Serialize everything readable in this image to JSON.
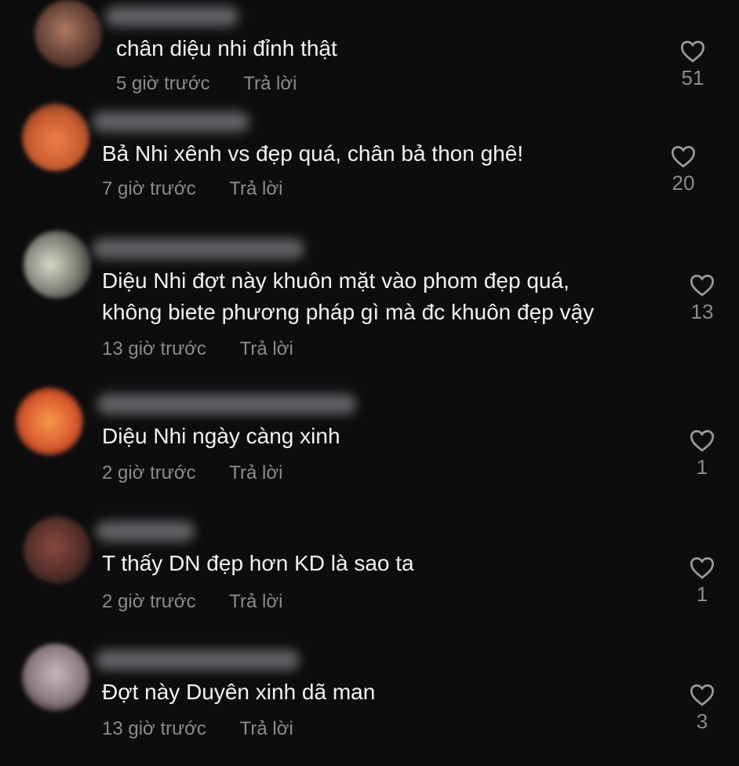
{
  "comments": [
    {
      "text_lines": [
        "chân diệu nhi đỉnh thật"
      ],
      "time": "5 giờ trước",
      "reply": "Trả lời",
      "likes": "51",
      "avatar_color": "#8a5a44"
    },
    {
      "text_lines": [
        "Bả Nhi xênh vs đẹp quá, chân bả thon ghê!"
      ],
      "time": "7 giờ trước",
      "reply": "Trả lời",
      "likes": "20",
      "avatar_color": "#d36a3c"
    },
    {
      "text_lines": [
        "Diệu Nhi đợt này khuôn mặt vào phom đẹp quá,",
        "không biete phương pháp gì mà đc khuôn đẹp vậy"
      ],
      "time": "13 giờ trước",
      "reply": "Trả lời",
      "likes": "13",
      "avatar_color": "#8a8a82"
    },
    {
      "text_lines": [
        "Diệu Nhi ngày càng xinh"
      ],
      "time": "2 giờ trước",
      "reply": "Trả lời",
      "likes": "1",
      "avatar_color": "#d9683a"
    },
    {
      "text_lines": [
        "T thấy DN đẹp hơn KD là sao ta"
      ],
      "time": "2 giờ trước",
      "reply": "Trả lời",
      "likes": "1",
      "avatar_color": "#5a3a34"
    },
    {
      "text_lines": [
        "Đợt này Duyên xinh dã man"
      ],
      "time": "13 giờ trước",
      "reply": "Trả lời",
      "likes": "3",
      "avatar_color": "#9e8e90"
    }
  ],
  "icons": {
    "like": "heart-outline-icon"
  }
}
